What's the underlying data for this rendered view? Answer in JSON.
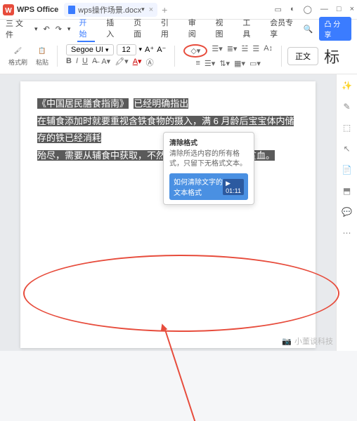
{
  "titlebar": {
    "app_name": "WPS Office",
    "doc_name": "wps操作场景.docx",
    "close": "×",
    "plus": "+"
  },
  "menubar": {
    "file": "三 文件",
    "tabs": [
      "开始",
      "插入",
      "页面",
      "引用",
      "审阅",
      "视图",
      "工具",
      "会员专享"
    ],
    "share": "凸 分享"
  },
  "toolbar": {
    "format_brush": "格式刷",
    "paste": "粘贴",
    "font_name": "Segoe UI",
    "font_size": "12",
    "zw": "正文",
    "big": "标"
  },
  "tooltip": {
    "title": "清除格式",
    "body": "清除所选内容的所有格式，只留下无格式文本。",
    "link": "如何清除文字的文本格式",
    "time": "01:11"
  },
  "doc": {
    "line1a": "《中国居民膳食指南》",
    "line1b": "已经明确指出",
    "line2": "在辅食添加时就要重视含铁食物的摄入，满 6 月龄后宝宝体内储存的铁已经消耗",
    "line3": "殆尽，需要从辅食中获取，不然很可能会造成缺铁性贫血。"
  },
  "watermark": "小董谈科技"
}
